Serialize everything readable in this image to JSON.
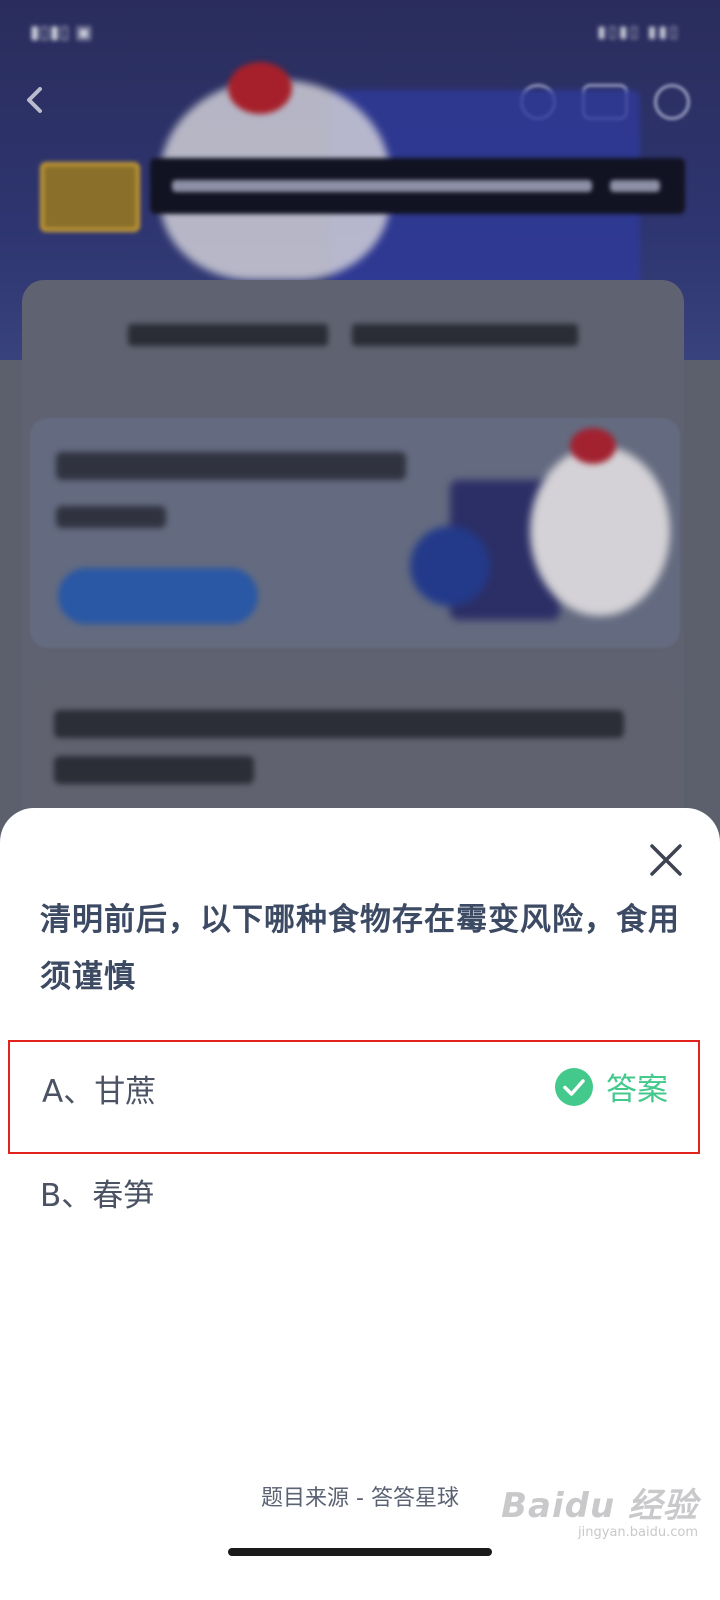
{
  "sheet": {
    "question": "清明前后，以下哪种食物存在霉变风险，食用须谨慎",
    "options": [
      {
        "label": "A、甘蔗",
        "is_answer": true,
        "answer_badge": "答案"
      },
      {
        "label": "B、春笋",
        "is_answer": false
      }
    ],
    "source_text": "题目来源 - 答答星球",
    "close_icon": "close-icon"
  },
  "watermark": {
    "brand": "Baidu 经验",
    "url": "jingyan.baidu.com"
  },
  "colors": {
    "answer_green": "#43c98c",
    "highlight_red": "#e0241d",
    "question_text": "#3d4a63"
  }
}
